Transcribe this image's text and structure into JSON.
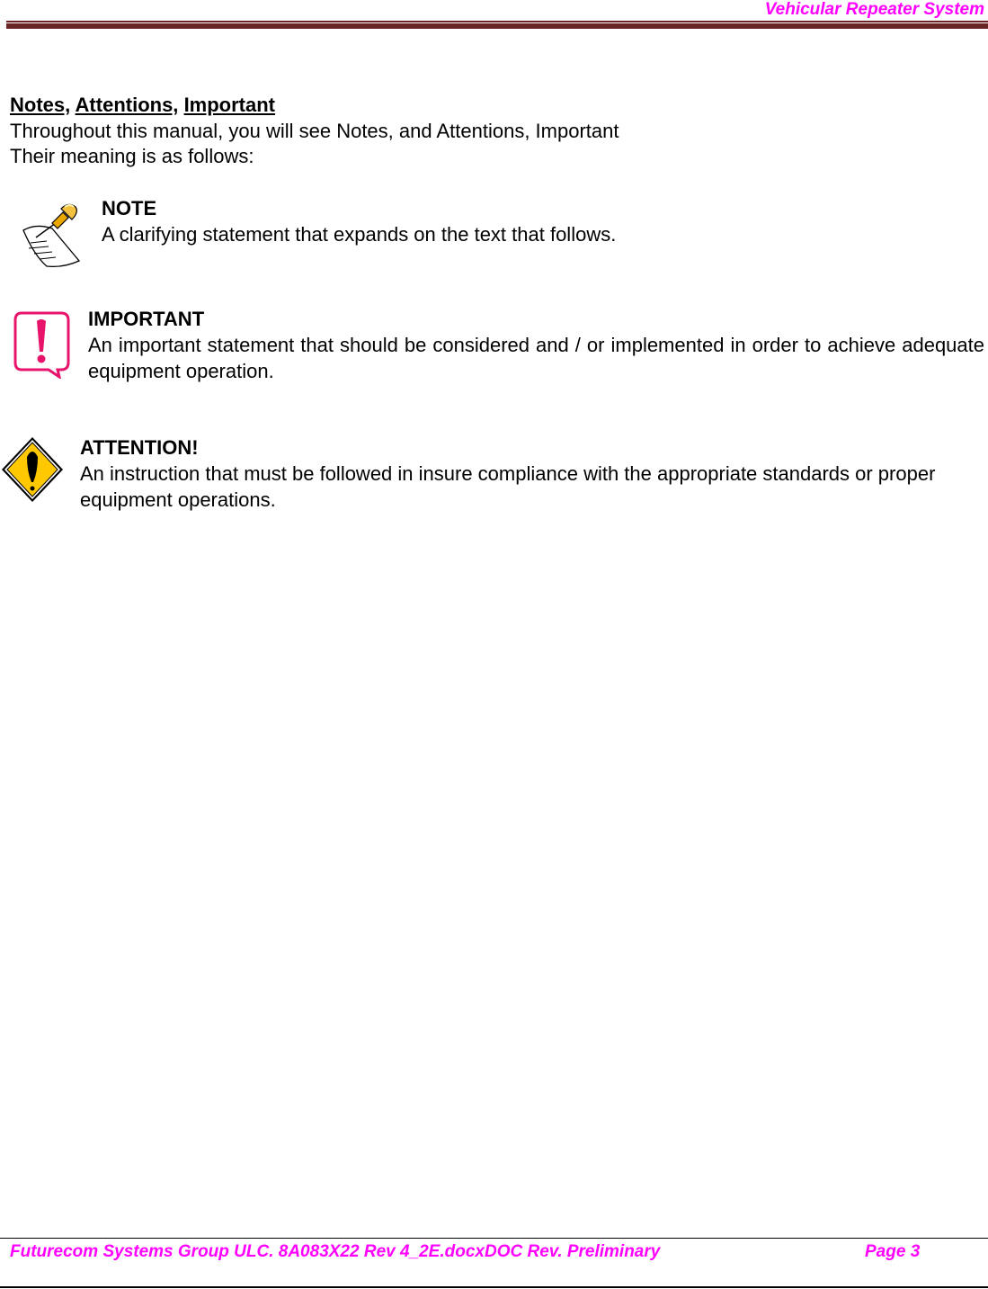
{
  "header": {
    "title": "Vehicular Repeater System",
    "accent_color": "#ff00ff",
    "rule_color": "#6b2424"
  },
  "section": {
    "title_parts": [
      "Notes,",
      "Attentions,",
      "Important"
    ],
    "intro_line1": "Throughout this manual, you will see Notes, and Attentions, Important",
    "intro_line2": "Their meaning is as follows:"
  },
  "notices": {
    "note": {
      "icon": "pushpin-note-icon",
      "heading": "NOTE",
      "text": "A clarifying statement that expands on the text that follows."
    },
    "important": {
      "icon": "exclamation-bubble-icon",
      "icon_color": "#e8146c",
      "heading": "IMPORTANT",
      "text": "An important statement that should be considered and / or implemented in order to achieve adequate equipment operation."
    },
    "attention": {
      "icon": "warning-diamond-icon",
      "icon_color": "#ffc800",
      "heading": "ATTENTION!",
      "text": "An instruction that must be followed in insure compliance with the appropriate standards or proper equipment operations."
    }
  },
  "footer": {
    "doc_info": "Futurecom Systems Group ULC. 8A083X22 Rev 4_2E.docxDOC Rev. Preliminary",
    "page_label": "Page 3"
  }
}
